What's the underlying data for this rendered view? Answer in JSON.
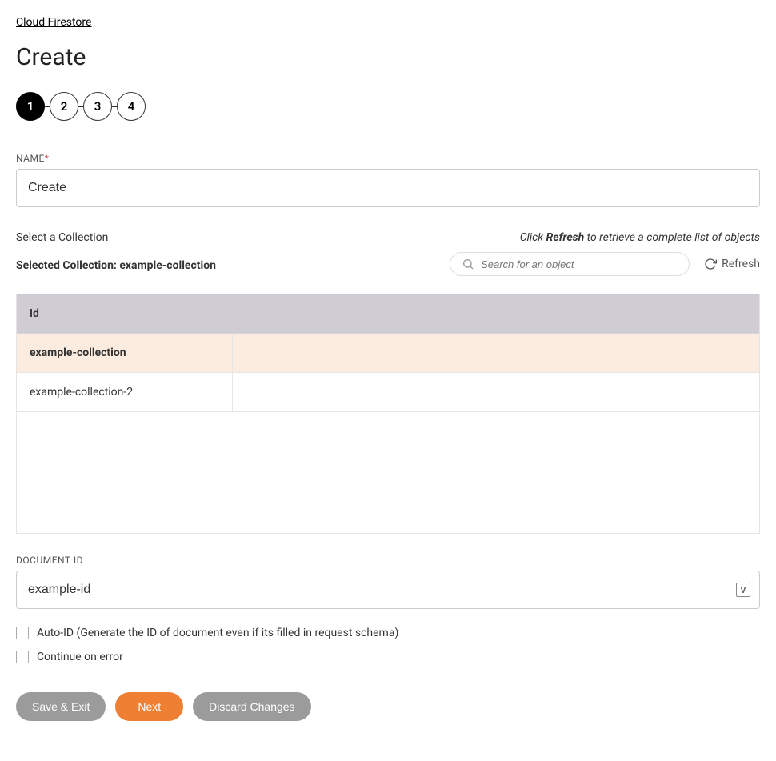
{
  "breadcrumb": {
    "label": "Cloud Firestore"
  },
  "page": {
    "title": "Create"
  },
  "stepper": {
    "steps": [
      "1",
      "2",
      "3",
      "4"
    ],
    "active_index": 0
  },
  "name_field": {
    "label": "NAME",
    "value": "Create"
  },
  "collection": {
    "select_label": "Select a Collection",
    "hint_prefix": "Click ",
    "hint_bold": "Refresh",
    "hint_suffix": " to retrieve a complete list of objects",
    "selected_prefix": "Selected Collection: ",
    "selected_value": "example-collection",
    "search_placeholder": "Search for an object",
    "refresh_label": "Refresh",
    "header": "Id",
    "rows": [
      {
        "id": "example-collection",
        "selected": true
      },
      {
        "id": "example-collection-2",
        "selected": false
      }
    ]
  },
  "doc_id": {
    "label": "DOCUMENT ID",
    "value": "example-id"
  },
  "checkboxes": {
    "auto_id": "Auto-ID (Generate the ID of document even if its filled in request schema)",
    "continue_on_error": "Continue on error"
  },
  "actions": {
    "save_exit": "Save & Exit",
    "next": "Next",
    "discard": "Discard Changes"
  }
}
